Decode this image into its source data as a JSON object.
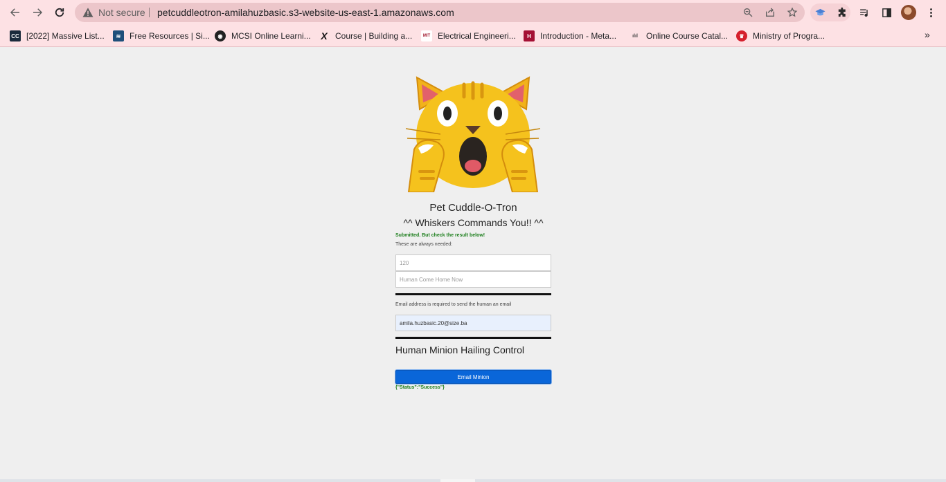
{
  "browser": {
    "security_label": "Not secure",
    "url": "petcuddleotron-amilahuzbasic.s3-website-us-east-1.amazonaws.com",
    "bookmarks": [
      {
        "label": "[2022] Massive List...",
        "icon": "cc-logo-icon"
      },
      {
        "label": "Free Resources | Si...",
        "icon": "site-logo-icon"
      },
      {
        "label": "MCSI Online Learni...",
        "icon": "globe-icon"
      },
      {
        "label": "Course | Building a...",
        "icon": "edx-logo-icon"
      },
      {
        "label": "Electrical Engineeri...",
        "icon": "mit-ocw-icon"
      },
      {
        "label": "Introduction - Meta...",
        "icon": "harvard-logo-icon"
      },
      {
        "label": "Online Course Catal...",
        "icon": "cisco-logo-icon"
      },
      {
        "label": "Ministry of Progra...",
        "icon": "crown-icon"
      }
    ],
    "more_label": "»"
  },
  "page": {
    "title": "Pet Cuddle-O-Tron",
    "subtitle": "^^ Whiskers Commands You!! ^^",
    "submit_message": "Submitted. But check the result below!",
    "required_note": "These are always needed:",
    "delay_placeholder": "120",
    "message_placeholder": "Human Come Home Now",
    "email_note": "Email address is required to send the human an email",
    "email_value": "amila.huzbasic.20@size.ba",
    "section_heading": "Human Minion Hailing Control",
    "email_button_label": "Email Minion",
    "result_text": "{\"Status\":\"Success\"}"
  }
}
